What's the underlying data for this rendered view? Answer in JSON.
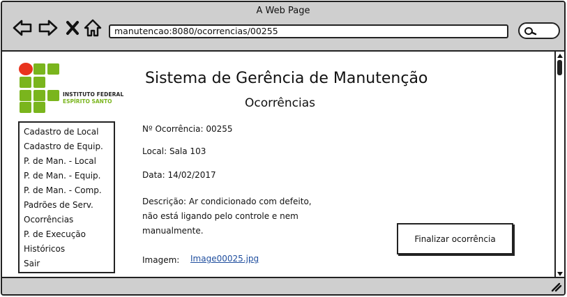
{
  "window": {
    "title": "A Web Page",
    "url": "manutencao:8080/ocorrencias/00255"
  },
  "logo": {
    "line1": "INSTITUTO FEDERAL",
    "line2": "ESPÍRITO SANTO",
    "colors": {
      "green": "#7ab51d",
      "red": "#e8331d"
    }
  },
  "header": {
    "title": "Sistema de Gerência de Manutenção",
    "subtitle": "Ocorrências"
  },
  "sidebar": {
    "items": [
      {
        "label": "Cadastro de Local"
      },
      {
        "label": "Cadastro de Equip."
      },
      {
        "label": "P. de Man. - Local"
      },
      {
        "label": "P. de Man. - Equip."
      },
      {
        "label": "P. de Man. - Comp."
      },
      {
        "label": "Padrões de Serv."
      },
      {
        "label": "Ocorrências"
      },
      {
        "label": "P. de Execução"
      },
      {
        "label": "Históricos"
      },
      {
        "label": "Sair"
      }
    ]
  },
  "occurrence": {
    "number": "Nº Ocorrência: 00255",
    "location": "Local: Sala 103",
    "date": "Data: 14/02/2017",
    "description_lines": [
      "Descrição: Ar condicionado com defeito,",
      "não está ligando pelo controle e nem",
      "manualmente."
    ],
    "image_label": "Imagem:",
    "image_link": "Image00025.jpg"
  },
  "actions": {
    "finalize_label": "Finalizar ocorrência"
  }
}
